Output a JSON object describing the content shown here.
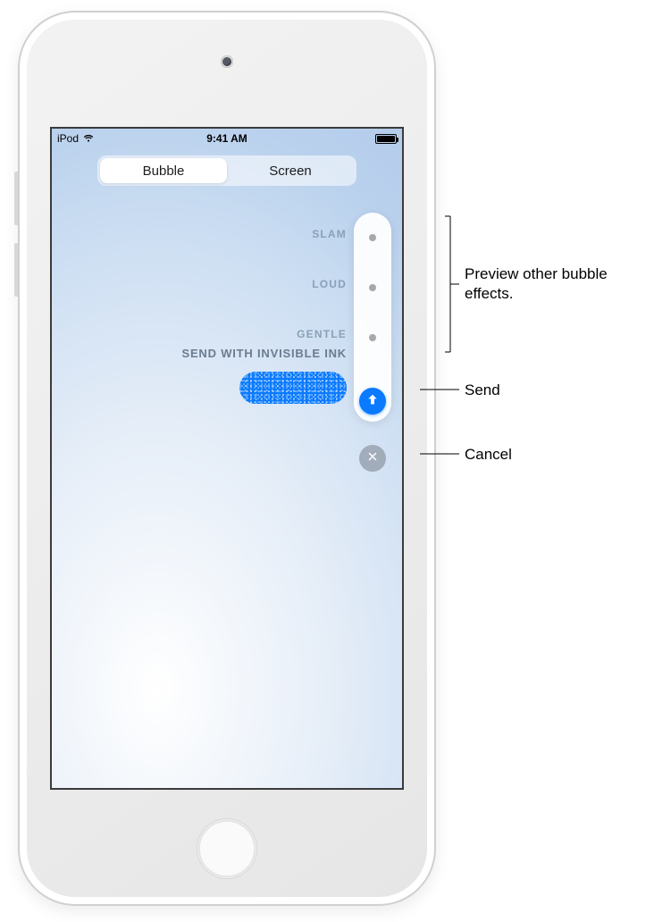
{
  "status": {
    "carrier": "iPod",
    "time": "9:41 AM"
  },
  "segmented": {
    "bubble": "Bubble",
    "screen": "Screen"
  },
  "effects": {
    "slam": "SLAM",
    "loud": "LOUD",
    "gentle": "GENTLE",
    "invisible_ink": "SEND WITH INVISIBLE INK"
  },
  "callouts": {
    "preview": "Preview other bubble effects.",
    "send": "Send",
    "cancel": "Cancel"
  }
}
